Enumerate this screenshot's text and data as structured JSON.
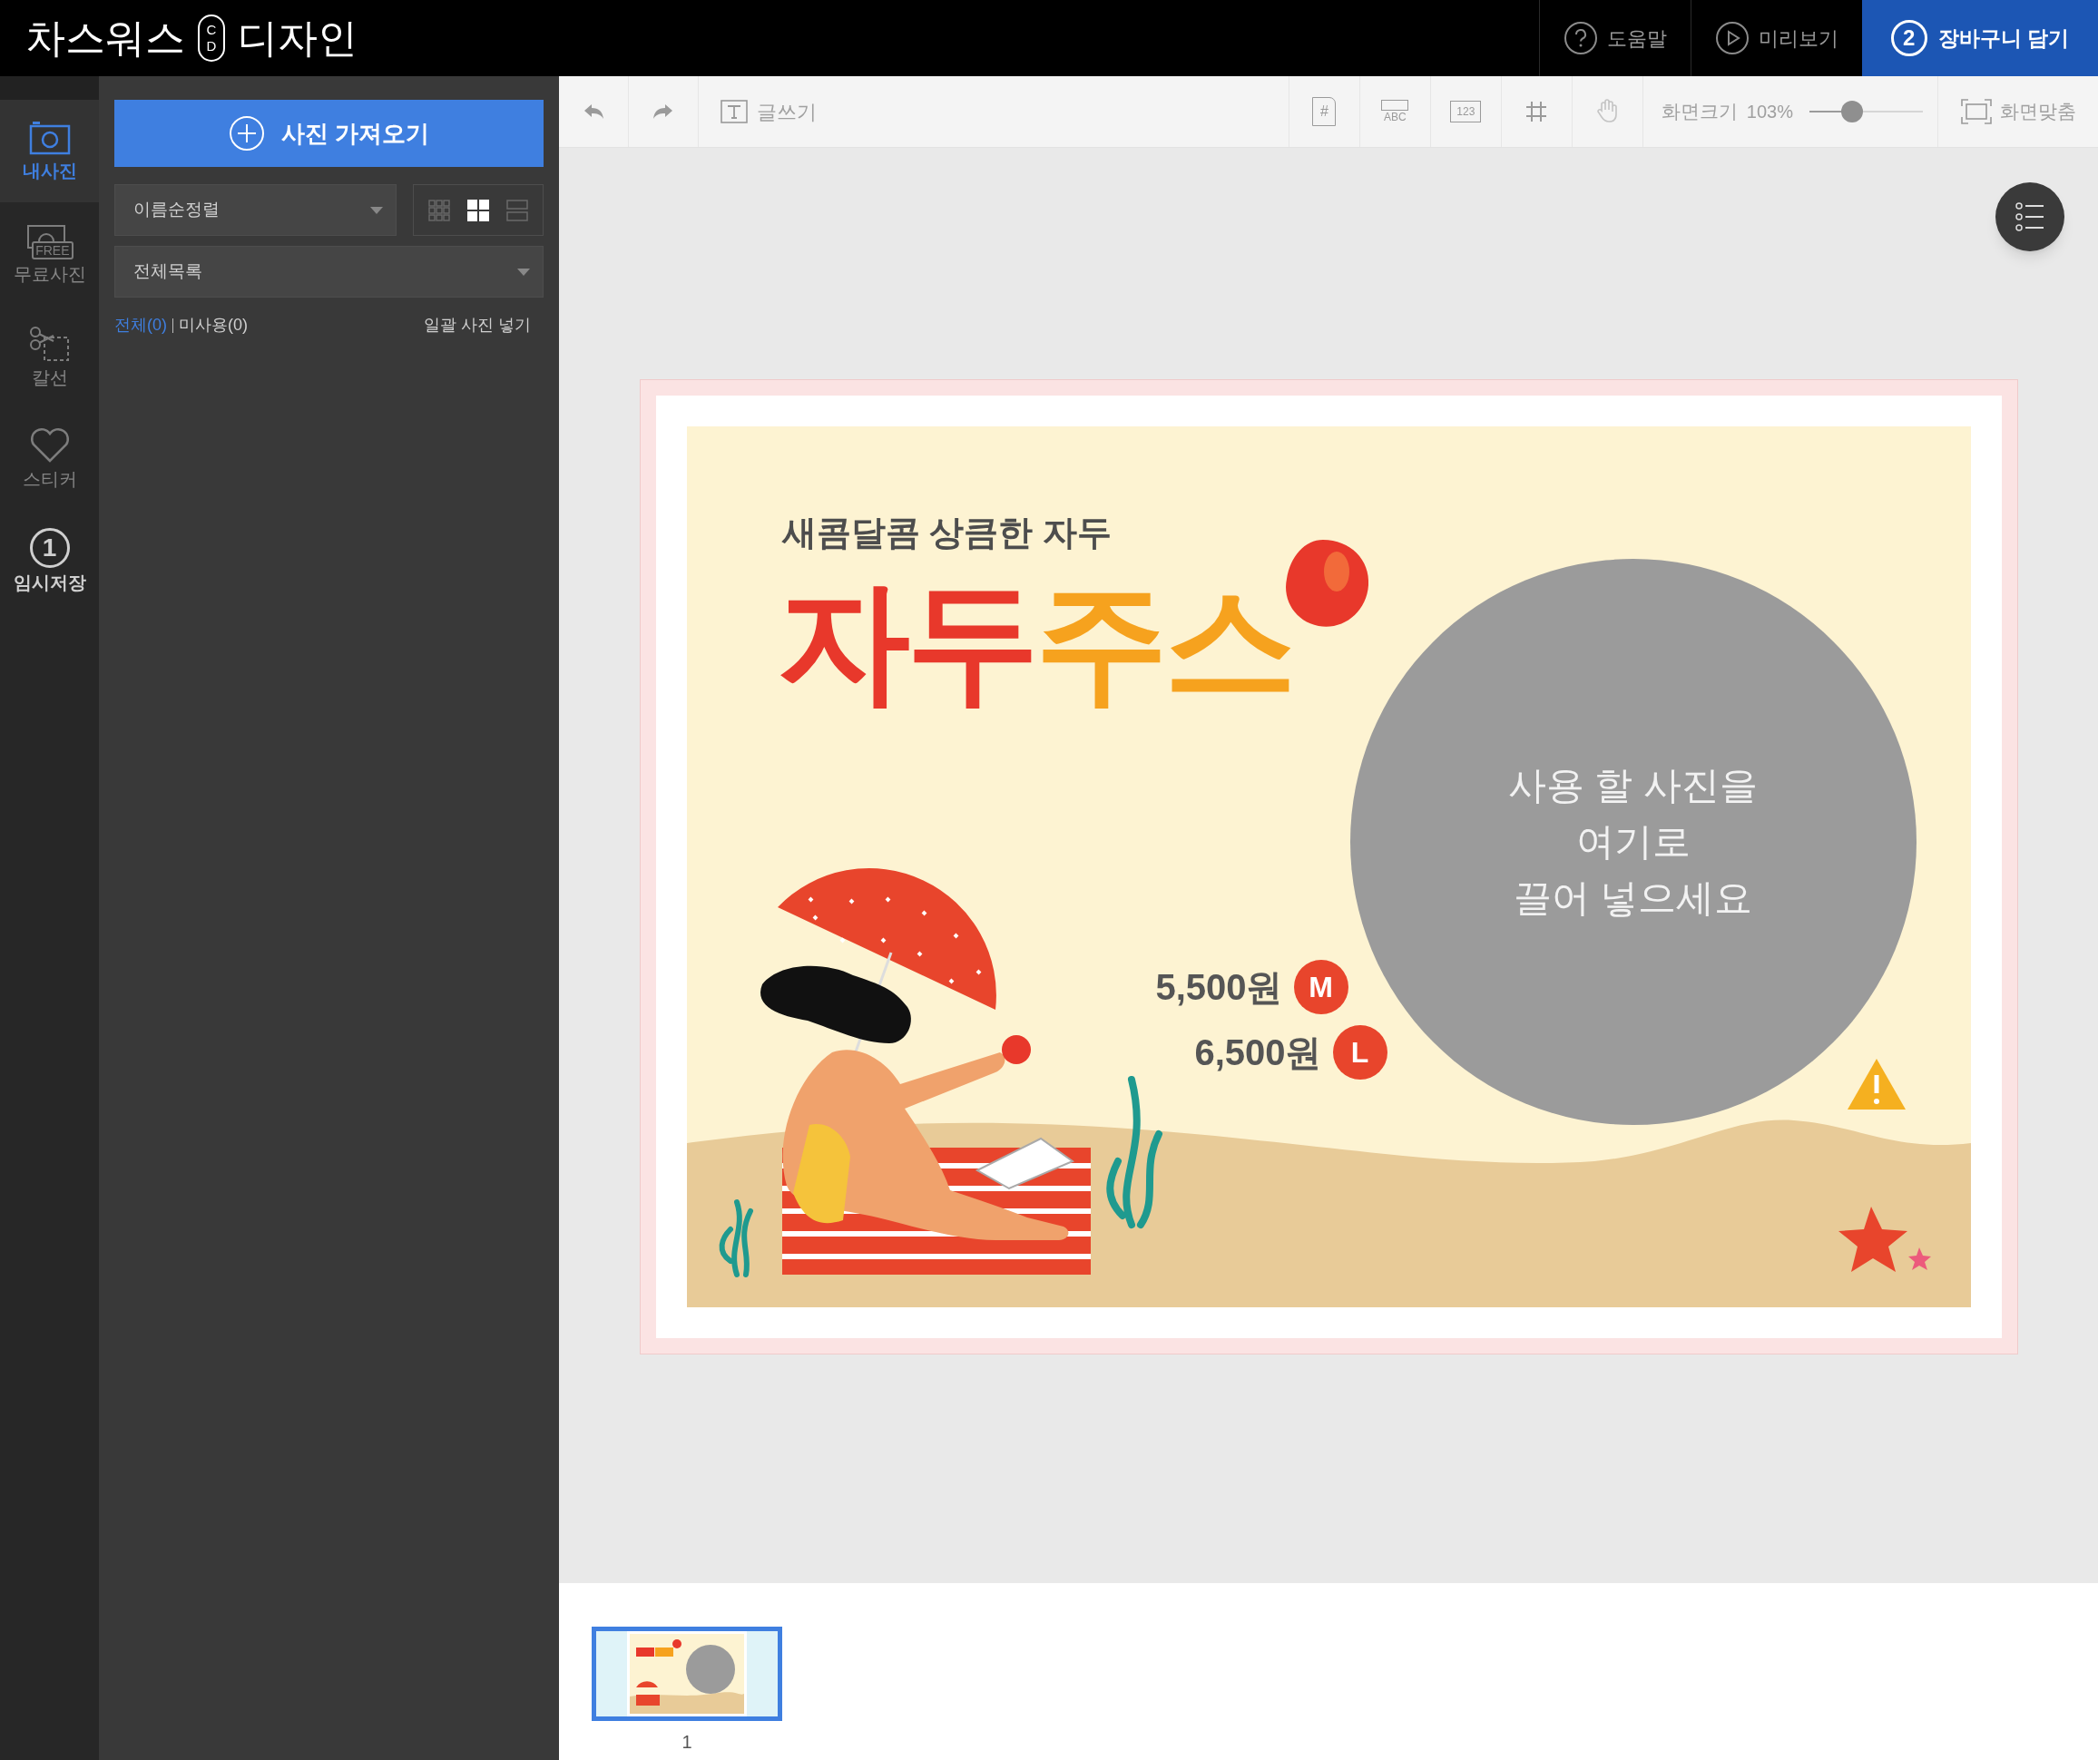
{
  "brand": {
    "name": "차스워스",
    "mark_top": "C",
    "mark_bottom": "D",
    "product": "디자인"
  },
  "header_buttons": [
    {
      "kind": "help",
      "label": "도움말"
    },
    {
      "kind": "preview",
      "label": "미리보기"
    },
    {
      "kind": "cart",
      "step": "2",
      "label": "장바구니 담기"
    }
  ],
  "rail": [
    {
      "kind": "photo",
      "label": "내사진",
      "selected": true
    },
    {
      "kind": "free",
      "icon_text": "FREE",
      "label": "무료사진",
      "selected": false
    },
    {
      "kind": "cut",
      "label": "칼선",
      "selected": false
    },
    {
      "kind": "sticker",
      "label": "스티커",
      "selected": false
    },
    {
      "kind": "save",
      "icon_text": "1",
      "label": "임시저장",
      "selected": false
    }
  ],
  "panel": {
    "import_button": "사진 가져오기",
    "sort": "이름순정렬",
    "views": [
      {
        "kind": "small",
        "selected": false
      },
      {
        "kind": "medium",
        "selected": true
      },
      {
        "kind": "list",
        "selected": false
      }
    ],
    "filter": "전체목록",
    "counts": [
      {
        "label": "전체(0)",
        "selected": true
      },
      {
        "label": "미사용(0)",
        "selected": false
      }
    ],
    "bulk_action": "일괄 사진 넣기"
  },
  "toolbar": {
    "left": [
      {
        "kind": "undo"
      },
      {
        "kind": "redo"
      },
      {
        "kind": "text",
        "label": "글쓰기"
      }
    ],
    "right": [
      {
        "kind": "page",
        "icon_text": "#"
      },
      {
        "kind": "textbox",
        "icon_text": "ABC"
      },
      {
        "kind": "number",
        "icon_text": "123"
      },
      {
        "kind": "grid"
      },
      {
        "kind": "hand"
      }
    ],
    "zoom_label": "화면크기",
    "zoom_value": "103%",
    "zoom": {
      "level": 0.35
    },
    "fit": "화면맞춤"
  },
  "design": {
    "subtitle": "새콤달콤 상큼한 자두",
    "title": [
      {
        "text": "자두",
        "color": "#e8382b"
      },
      {
        "text": "주스",
        "color": "#f6a21e"
      }
    ],
    "drop_hint": [
      "사용 할 사진을",
      "여기로",
      "끌어 넣으세요"
    ],
    "prices": [
      {
        "price": "5,500원",
        "size": "M"
      },
      {
        "price": "6,500원",
        "size": "L"
      }
    ]
  },
  "pages": [
    {
      "label": "1",
      "selected": true
    }
  ]
}
